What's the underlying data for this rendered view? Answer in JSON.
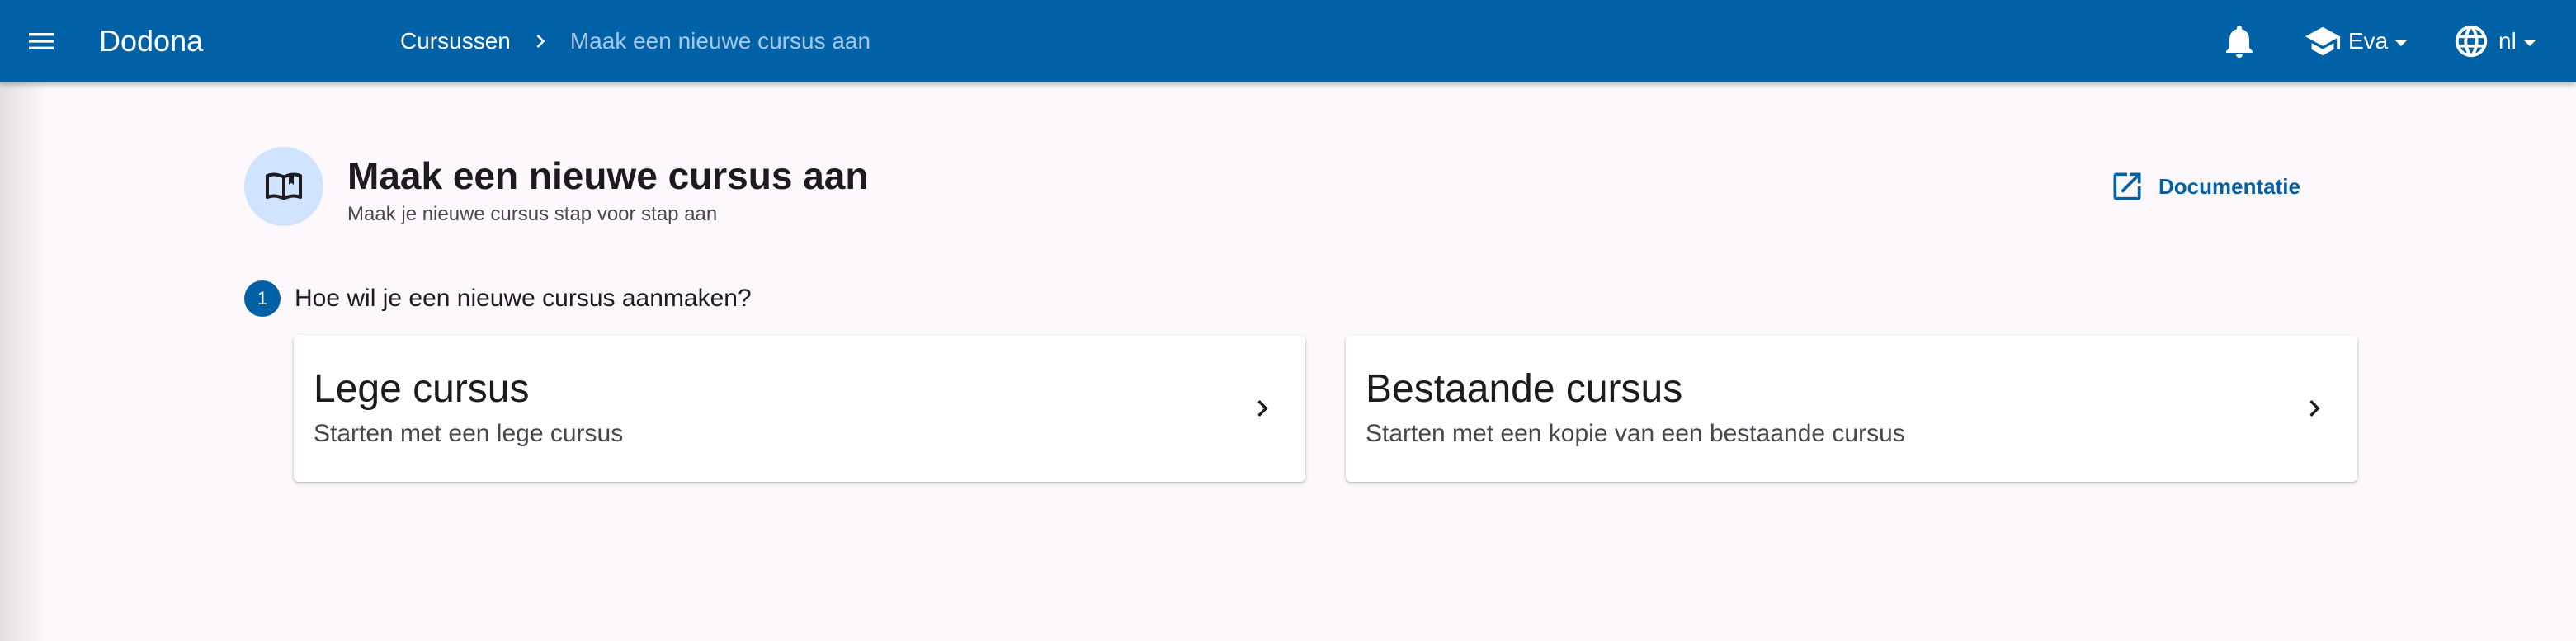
{
  "app": {
    "name": "Dodona"
  },
  "breadcrumb": {
    "parent": "Cursussen",
    "current": "Maak een nieuwe cursus aan"
  },
  "user_menu": {
    "name": "Eva"
  },
  "language_menu": {
    "code": "nl"
  },
  "page": {
    "title": "Maak een nieuwe cursus aan",
    "subtitle": "Maak je nieuwe cursus stap voor stap aan",
    "doc_link": "Documentatie",
    "icon": "book-open-icon"
  },
  "step": {
    "number": "1",
    "question": "Hoe wil je een nieuwe cursus aanmaken?"
  },
  "options": [
    {
      "title": "Lege cursus",
      "description": "Starten met een lege cursus"
    },
    {
      "title": "Bestaande cursus",
      "description": "Starten met een kopie van een bestaande cursus"
    }
  ],
  "colors": {
    "primary": "#0061a6",
    "background": "#fcf8fc",
    "icon_circle": "#d1e4ff",
    "breadcrumb_current": "#a8c8ea"
  }
}
